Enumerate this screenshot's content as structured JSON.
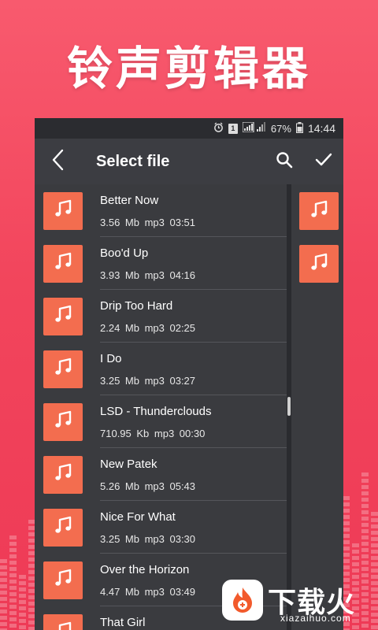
{
  "banner": {
    "title": "铃声剪辑器"
  },
  "status_bar": {
    "battery": "67%",
    "time": "14:44",
    "sim_label": "1"
  },
  "toolbar": {
    "title": "Select file"
  },
  "files": [
    {
      "title": "Better Now",
      "meta": "3.56 Mb  mp3  03:51"
    },
    {
      "title": "Boo'd Up",
      "meta": "3.93 Mb  mp3  04:16"
    },
    {
      "title": "Drip Too Hard",
      "meta": "2.24 Mb  mp3  02:25"
    },
    {
      "title": "I Do",
      "meta": "3.25 Mb  mp3  03:27"
    },
    {
      "title": "LSD - Thunderclouds",
      "meta": "710.95 Kb  mp3  00:30"
    },
    {
      "title": "New Patek",
      "meta": "5.26 Mb  mp3  05:43"
    },
    {
      "title": "Nice For What",
      "meta": "3.25 Mb  mp3  03:30"
    },
    {
      "title": "Over the Horizon",
      "meta": "4.47 Mb  mp3  03:49"
    },
    {
      "title": "That Girl",
      "meta": ""
    }
  ],
  "watermark": {
    "name": "下载火",
    "url": "xiazaihuo.com"
  },
  "colors": {
    "accent": "#f36d4f",
    "background": "#ee3a56",
    "panel": "#3a3b3f"
  },
  "icons": {
    "back": "chevron-left-icon",
    "search": "search-icon",
    "confirm": "check-icon",
    "file": "music-note-icon"
  }
}
